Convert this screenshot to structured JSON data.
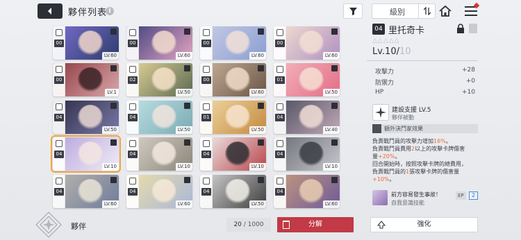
{
  "header": {
    "title": "夥伴列表",
    "info_icon": "i",
    "sort_label": "級別",
    "icons": [
      "back-arrow-icon",
      "info-icon",
      "filter-icon",
      "sort-order-icon",
      "home-icon",
      "menu-icon"
    ]
  },
  "cards": [
    {
      "num": "00",
      "level": "LV.60",
      "colors": [
        "#7a6fd0",
        "#2d3c6b"
      ],
      "face": "#f0d6c9"
    },
    {
      "num": "00",
      "level": "LV.60",
      "colors": [
        "#3d3f7c",
        "#e4a5c2"
      ],
      "face": "#f3dccf"
    },
    {
      "num": "00",
      "level": "LV.60",
      "colors": [
        "#c9cde6",
        "#8a9ed2"
      ],
      "face": "#f1e0d8"
    },
    {
      "num": "00",
      "level": "LV.60",
      "colors": [
        "#f5e3d2",
        "#b08fc1"
      ],
      "face": "#f4ded3"
    },
    {
      "num": "00",
      "level": "LV.1",
      "colors": [
        "#8e3a42",
        "#d9a7a8"
      ],
      "face": "#3a2226"
    },
    {
      "num": "02",
      "level": "LV.50",
      "colors": [
        "#e8d79a",
        "#5b6a53"
      ],
      "face": "#f6e2c7"
    },
    {
      "num": "00",
      "level": "LV.60",
      "colors": [
        "#c9b39c",
        "#6b5446"
      ],
      "face": "#f0dcc8"
    },
    {
      "num": "01",
      "level": "LV.50",
      "colors": [
        "#f3b7be",
        "#e46d86"
      ],
      "face": "#f6dfd4"
    },
    {
      "num": "04",
      "level": "LV.50",
      "colors": [
        "#2c2c44",
        "#7a78a8"
      ],
      "face": "#e9d7d3"
    },
    {
      "num": "04",
      "level": "LV.50",
      "colors": [
        "#bfe3e6",
        "#7aaab4"
      ],
      "face": "#f1e4dd"
    },
    {
      "num": "01",
      "level": "LV.50",
      "colors": [
        "#f2d9a6",
        "#c48a3f"
      ],
      "face": "#f7e4cf"
    },
    {
      "num": "04",
      "level": "LV.40",
      "colors": [
        "#4a4c5c",
        "#c2a9b8"
      ],
      "face": "#f0ddd6"
    },
    {
      "num": "04",
      "level": "LV.10",
      "colors": [
        "#b7a3dc",
        "#f0ecf7"
      ],
      "face": "#f4e6e2",
      "selected": true
    },
    {
      "num": "04",
      "level": "LV.10",
      "colors": [
        "#d8d3ca",
        "#8c8579"
      ],
      "face": "#f4e8df"
    },
    {
      "num": "04",
      "level": "LV.10",
      "colors": [
        "#f0f0f0",
        "#b8454a"
      ],
      "face": "#2d2d30"
    },
    {
      "num": "04",
      "level": "LV.10",
      "colors": [
        "#6a6c74",
        "#c7c8cc"
      ],
      "face": "#3a3c44"
    },
    {
      "num": "04",
      "level": "LV.60",
      "colors": [
        "#b9b6ad",
        "#6f7b9c"
      ],
      "face": "#e9e4d6"
    },
    {
      "num": "04",
      "level": "LV.60",
      "colors": [
        "#eedfa6",
        "#a8b8d8"
      ],
      "face": "#f6e8d6"
    },
    {
      "num": "04",
      "level": "LV.50",
      "colors": [
        "#d8d8d8",
        "#3d3d3d"
      ],
      "face": "#f2efe9"
    },
    {
      "num": "04",
      "level": "LV.60",
      "colors": [
        "#c79b7a",
        "#6e5a9a"
      ],
      "face": "#e8cdb2"
    }
  ],
  "detail": {
    "num": "04",
    "name": "里托奇卡",
    "stars": "△△△△△",
    "level_current": "Lv.10/",
    "level_max": "10",
    "stats": [
      {
        "label": "攻擊力",
        "value": "+28"
      },
      {
        "label": "防禦力",
        "value": "+0"
      },
      {
        "label": "HP",
        "value": "+10"
      }
    ],
    "skill_name": "建設支援 LV.5",
    "skill_type": "夥伴被動",
    "extra_label": "額外決鬥家效果",
    "desc": {
      "l1a": "負責戰鬥員的攻擊力增加",
      "l1b": "16%",
      "l1c": "。",
      "l2a": "負責戰鬥員費用",
      "l2b": "2",
      "l2c": "以上的攻擊卡牌傷害",
      "l3a": "量",
      "l3b": "+20%",
      "l3c": "。",
      "l4": "回合開始時，按照攻擊卡牌的總費用，",
      "l5a": "負責戰鬥員的",
      "l5b": "1",
      "l5c": "張攻擊卡牌的傷害量",
      "l6a": "+10%",
      "l6b": "。"
    },
    "ep_title": "前方容易發生事故！",
    "ep_sub": "自我意識技能",
    "ep_tag": "EP",
    "ep_count": "2"
  },
  "footer": {
    "label": "夥伴",
    "count_current": "20",
    "count_total": " / 1000",
    "dismantle_label": "分解",
    "enhance_label": "強化"
  }
}
